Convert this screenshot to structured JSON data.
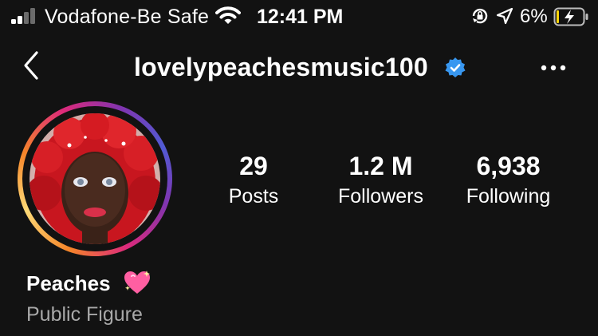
{
  "status_bar": {
    "carrier": "Vodafone-Be Safe",
    "time": "12:41 PM",
    "battery_percent": "6%",
    "icons": [
      "signal-icon",
      "wifi-icon",
      "orientation-lock-icon",
      "location-arrow-icon",
      "battery-charging-icon"
    ]
  },
  "header": {
    "username": "lovelypeachesmusic100",
    "verified": true,
    "icons": [
      "back-icon",
      "verified-badge-icon",
      "more-icon"
    ]
  },
  "profile": {
    "avatar_icon": "profile-photo",
    "stats": [
      {
        "value": "29",
        "label": "Posts"
      },
      {
        "value": "1.2 M",
        "label": "Followers"
      },
      {
        "value": "6,938",
        "label": "Following"
      }
    ],
    "display_name": "Peaches",
    "name_emoji": "sparkling-heart-icon",
    "category": "Public Figure"
  },
  "colors": {
    "background": "#121212",
    "text": "#ffffff",
    "secondary_text": "#a8a8a8",
    "verified_blue": "#3897f0",
    "battery_low": "#ffd60a"
  }
}
